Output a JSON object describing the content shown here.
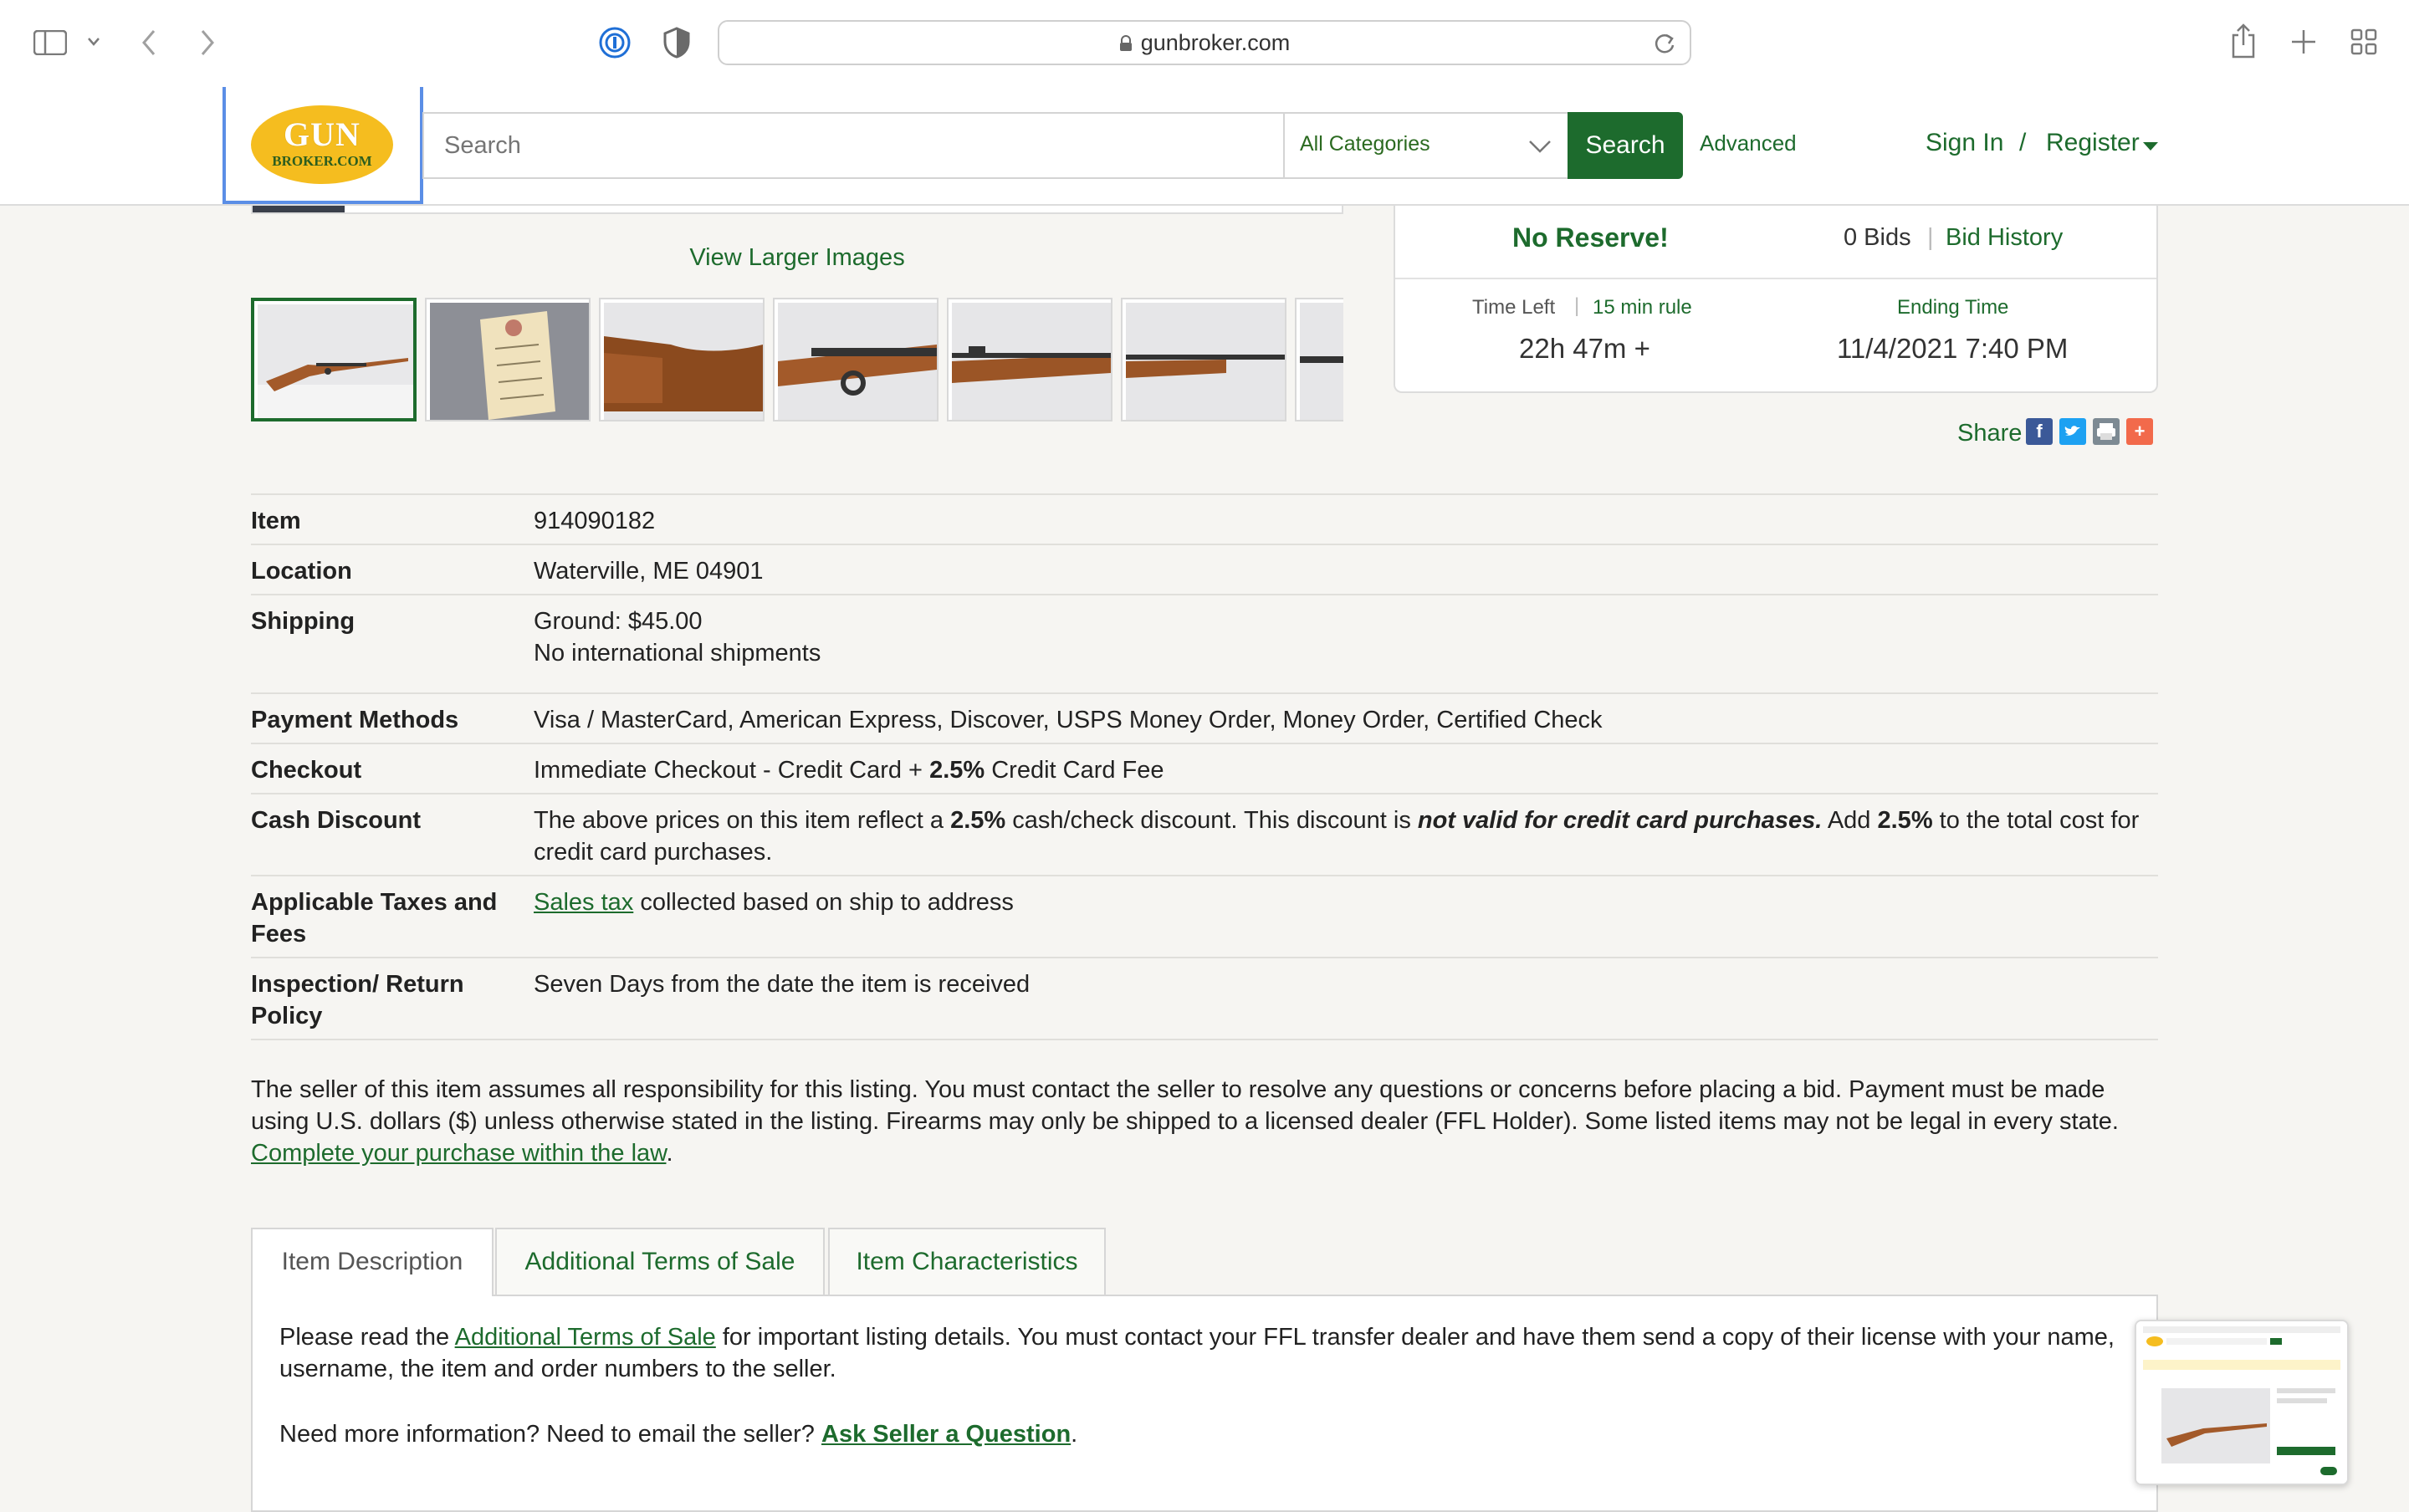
{
  "browser": {
    "url": "gunbroker.com",
    "lock_icon": "lock-icon",
    "reload_icon": "reload-icon"
  },
  "header": {
    "logo_main": "GUN",
    "logo_sub": "BROKER.COM",
    "search_placeholder": "Search",
    "category": "All Categories",
    "search_button": "Search",
    "advanced": "Advanced",
    "sign_in": "Sign In",
    "slash": "/",
    "register": "Register"
  },
  "gallery": {
    "view_larger": "View Larger Images"
  },
  "bid_panel": {
    "no_reserve": "No Reserve!",
    "bids": "0 Bids",
    "bid_history": "Bid History",
    "time_left_label": "Time Left",
    "rule": "15 min rule",
    "time_left_value": "22h 47m +",
    "ending_label": "Ending Time",
    "ending_value": "11/4/2021 7:40 PM",
    "share": "Share"
  },
  "details": {
    "item_label": "Item",
    "item_value": "914090182",
    "location_label": "Location",
    "location_value": "Waterville, ME 04901",
    "shipping_label": "Shipping",
    "shipping_value_1": "Ground: $45.00",
    "shipping_value_2": "No international shipments",
    "payment_label": "Payment Methods",
    "payment_value": "Visa / MasterCard, American Express, Discover, USPS Money Order, Money Order, Certified Check",
    "checkout_label": "Checkout",
    "checkout_pre": "Immediate Checkout - Credit Card + ",
    "checkout_pct": "2.5%",
    "checkout_post": " Credit Card Fee",
    "cash_label": "Cash Discount",
    "cash_pre": "The above prices on this item reflect a ",
    "cash_pct1": "2.5%",
    "cash_mid": " cash/check discount. This discount is ",
    "cash_em": "not valid for credit card purchases.",
    "cash_add": " Add ",
    "cash_pct2": "2.5%",
    "cash_post": " to the total cost for credit card purchases.",
    "taxes_label": "Applicable Taxes and Fees",
    "taxes_link": "Sales tax",
    "taxes_post": " collected based on ship to address",
    "return_label": "Inspection/ Return Policy",
    "return_value": "Seven Days from the date the item is received"
  },
  "disclaimer": {
    "text": "The seller of this item assumes all responsibility for this listing. You must contact the seller to resolve any questions or concerns before placing a bid. Payment must be made using U.S. dollars ($) unless otherwise stated in the listing. Firearms may only be shipped to a licensed dealer (FFL Holder). Some listed items may not be legal in every state. ",
    "link": "Complete your purchase within the law",
    "end": "."
  },
  "tabs": {
    "description": "Item Description",
    "terms": "Additional Terms of Sale",
    "characteristics": "Item Characteristics"
  },
  "description": {
    "p1_pre": "Please read the ",
    "p1_link": "Additional Terms of Sale",
    "p1_post": " for important listing details. You must contact your FFL transfer dealer and have them send a copy of their license with your name, username, the item and order numbers to the seller.",
    "p2_pre": "Need more information? Need to email the seller? ",
    "p2_link": "Ask Seller a Question",
    "p2_end": "."
  },
  "colors": {
    "brand_green": "#1d6b2d",
    "logo_yellow": "#f5bd1f"
  }
}
